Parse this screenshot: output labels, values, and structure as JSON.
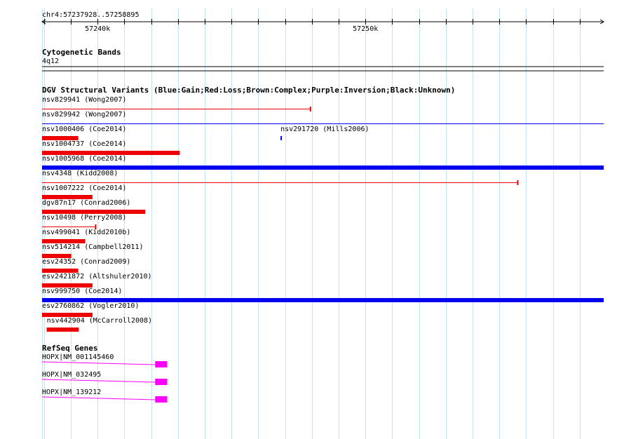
{
  "region": {
    "chrom": "chr4",
    "start": 57237928,
    "end": 57258895,
    "label": "chr4:57237928..57258895"
  },
  "ruler": {
    "ticks": [
      {
        "pos": 57240000,
        "label": "57240k"
      },
      {
        "pos": 57250000,
        "label": "57250k"
      }
    ]
  },
  "colors": {
    "gain": "#0000ee",
    "loss": "#ee0000",
    "gene": "#ff00ff",
    "grid": "#bfe6f2"
  },
  "tracks": {
    "cytoband": {
      "title": "Cytogenetic Bands",
      "band": "4q12"
    },
    "dgv": {
      "title": "DGV Structural Variants (Blue:Gain;Red:Loss;Brown:Complex;Purple:Inversion;Black:Unknown)",
      "variants": [
        {
          "id": "nsv829941",
          "study": "(Wong2007)",
          "type": "loss",
          "start": 57237928,
          "end": 57247960,
          "style": "thin",
          "row": 0,
          "col": 0
        },
        {
          "id": "nsv829942",
          "study": "(Wong2007)",
          "type": "gain",
          "start": 57237928,
          "end": 57258895,
          "style": "thin",
          "row": 1,
          "col": 0
        },
        {
          "id": "nsv1000406",
          "study": "(Coe2014)",
          "type": "loss",
          "start": 57237928,
          "end": 57239280,
          "style": "thick",
          "row": 2,
          "col": 0
        },
        {
          "id": "nsv291720",
          "study": "(Mills2006)",
          "type": "gain",
          "start": 57246830,
          "end": 57246880,
          "style": "thick",
          "row": 2,
          "col": 1
        },
        {
          "id": "nsv1004737",
          "study": "(Coe2014)",
          "type": "loss",
          "start": 57237928,
          "end": 57243070,
          "style": "thick",
          "row": 3,
          "col": 0
        },
        {
          "id": "nsv1005968",
          "study": "(Coe2014)",
          "type": "gain",
          "start": 57237928,
          "end": 57258895,
          "style": "thick",
          "row": 4,
          "col": 0
        },
        {
          "id": "nsv4348",
          "study": "(Kidd2008)",
          "type": "loss",
          "start": 57237928,
          "end": 57255700,
          "style": "thin",
          "row": 5,
          "col": 0
        },
        {
          "id": "nsv1007222",
          "study": "(Coe2014)",
          "type": "loss",
          "start": 57237928,
          "end": 57239810,
          "style": "thick",
          "row": 6,
          "col": 0
        },
        {
          "id": "dgv87n17",
          "study": "(Conrad2006)",
          "type": "loss",
          "start": 57237928,
          "end": 57241780,
          "style": "thick",
          "row": 7,
          "col": 0
        },
        {
          "id": "nsv10498",
          "study": "(Perry2008)",
          "type": "loss",
          "start": 57237928,
          "end": 57239940,
          "style": "thin",
          "row": 8,
          "col": 0
        },
        {
          "id": "nsv499041",
          "study": "(Kidd2010b)",
          "type": "loss",
          "start": 57237928,
          "end": 57239540,
          "style": "thick",
          "row": 9,
          "col": 0
        },
        {
          "id": "nsv514214",
          "study": "(Campbell2011)",
          "type": "loss",
          "start": 57237928,
          "end": 57239020,
          "style": "thick",
          "row": 10,
          "col": 0
        },
        {
          "id": "esv24352",
          "study": "(Conrad2009)",
          "type": "loss",
          "start": 57237928,
          "end": 57239280,
          "style": "thick",
          "row": 11,
          "col": 0
        },
        {
          "id": "esv2421872",
          "study": "(Altshuler2010)",
          "type": "loss",
          "start": 57237928,
          "end": 57239810,
          "style": "thick",
          "row": 12,
          "col": 0
        },
        {
          "id": "nsv999750",
          "study": "(Coe2014)",
          "type": "gain",
          "start": 57237928,
          "end": 57258895,
          "style": "thick",
          "row": 13,
          "col": 0
        },
        {
          "id": "esv2760862",
          "study": "(Vogler2010)",
          "type": "loss",
          "start": 57237928,
          "end": 57239810,
          "style": "thick",
          "row": 14,
          "col": 0
        },
        {
          "id": "nsv442904",
          "study": "(McCarroll2008)",
          "type": "loss",
          "start": 57238100,
          "end": 57239300,
          "style": "thick",
          "row": 15,
          "col": 0
        }
      ]
    },
    "refseq": {
      "title": "RefSeq Genes",
      "genes": [
        {
          "name": "HOPX|NM_001145460",
          "intron_start": 57237928,
          "intron_end": 57242150,
          "exon_start": 57242150,
          "exon_end": 57242600
        },
        {
          "name": "HOPX|NM_032495",
          "intron_start": 57237928,
          "intron_end": 57242150,
          "exon_start": 57242150,
          "exon_end": 57242600
        },
        {
          "name": "HOPX|NM_139212",
          "intron_start": 57237928,
          "intron_end": 57242150,
          "exon_start": 57242150,
          "exon_end": 57242600
        }
      ]
    }
  }
}
